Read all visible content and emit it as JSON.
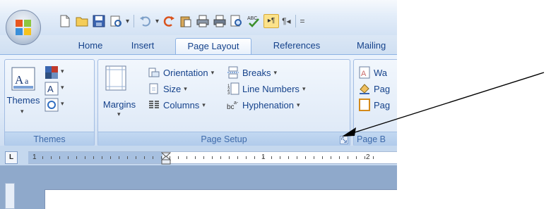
{
  "qat": {
    "active_label": "▸¶",
    "pilcrow_label": "¶◂",
    "more_label": "="
  },
  "tabs": [
    {
      "label": "Home"
    },
    {
      "label": "Insert"
    },
    {
      "label": "Page Layout"
    },
    {
      "label": "References"
    },
    {
      "label": "Mailing"
    }
  ],
  "groups": {
    "themes": {
      "label": "Themes",
      "themes_button": "Themes"
    },
    "page_setup": {
      "label": "Page Setup",
      "margins": "Margins",
      "orientation": "Orientation",
      "size": "Size",
      "columns": "Columns",
      "breaks": "Breaks",
      "line_numbers": "Line Numbers",
      "hyphenation": "Hyphenation"
    },
    "page_background": {
      "label": "Page B",
      "watermark": "Wa",
      "page_color": "Pag",
      "page_borders": "Pag"
    }
  },
  "ruler": {
    "corner": "L",
    "numbers": [
      "1",
      "1",
      "2"
    ]
  },
  "colors": {
    "ribbon_text": "#15428b",
    "group_label_text": "#3e6aaa",
    "ruler_margin": "#a7c0e0",
    "arrow": "#000000"
  },
  "icons": {
    "office": "office-logo-icon",
    "save": "save-icon",
    "undo": "undo-icon",
    "redo": "redo-icon",
    "print": "print-icon",
    "spell": "spell-check-icon",
    "launcher": "dialog-launcher-icon"
  }
}
